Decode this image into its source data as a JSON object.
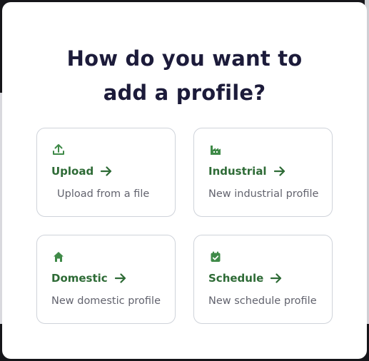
{
  "dialog": {
    "title_line1": "How do you want to",
    "title_line2": "add a profile?"
  },
  "options": [
    {
      "label": "Upload",
      "description": "Upload from a file",
      "icon": "upload-icon"
    },
    {
      "label": "Industrial",
      "description": "New industrial profile",
      "icon": "factory-icon"
    },
    {
      "label": "Domestic",
      "description": "New domestic profile",
      "icon": "home-icon"
    },
    {
      "label": "Schedule",
      "description": "New schedule profile",
      "icon": "calendar-check-icon"
    }
  ],
  "colors": {
    "accent": "#2e6b36",
    "icon_green": "#3f8a48",
    "title": "#1c1b3a",
    "description": "#62636e",
    "card_border": "#cfd3da"
  }
}
